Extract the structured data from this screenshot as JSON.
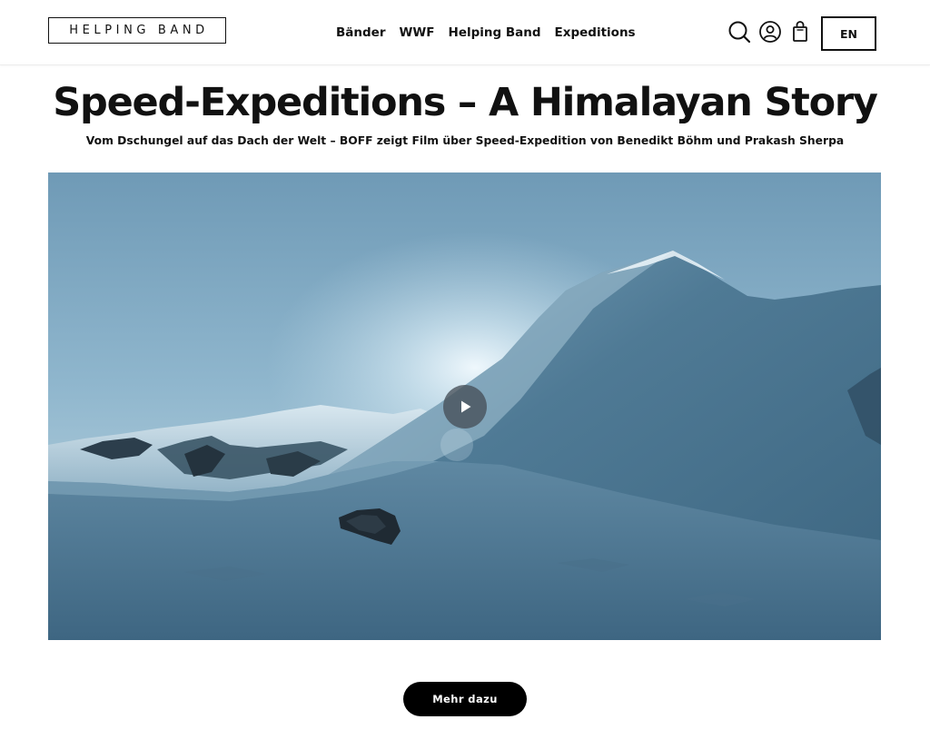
{
  "header": {
    "logo_text": "HELPING BAND",
    "nav": [
      {
        "label": "Bänder"
      },
      {
        "label": "WWF"
      },
      {
        "label": "Helping Band"
      },
      {
        "label": "Expeditions"
      }
    ],
    "icons": [
      "search-icon",
      "account-icon",
      "shopping-bag-icon"
    ],
    "language_label": "EN"
  },
  "main": {
    "title": "Speed-Expeditions – A Himalayan Story",
    "subtitle": "Vom Dschungel auf das Dach der Welt – BOFF zeigt Film über Speed-Expedition von Benedikt Böhm und Prakash Sherpa",
    "video": {
      "play_icon": "play-icon"
    },
    "more_button_label": "Mehr dazu"
  },
  "colors": {
    "text": "#111111",
    "button_bg": "#000000",
    "button_text": "#ffffff",
    "sky_top": "#5d8fad",
    "snow_shadow": "#3d6580"
  }
}
